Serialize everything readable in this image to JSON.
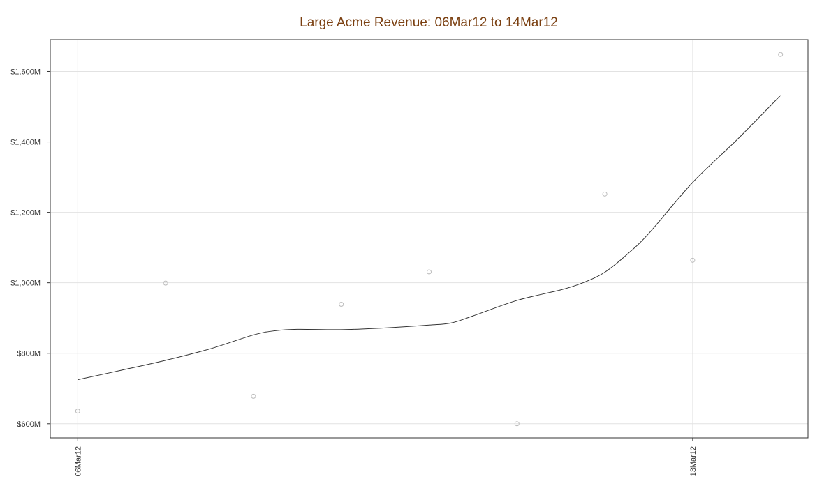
{
  "colors": {
    "title": "#7a3f10",
    "grid": "#e2e2e2",
    "frame": "#333333",
    "trend_line": "#333333",
    "points": "#bbbbbb",
    "tick_label": "#333333"
  },
  "chart_data": {
    "type": "scatter",
    "title": "Large Acme Revenue: 06Mar12 to 14Mar12",
    "xlabel": "",
    "ylabel": "",
    "xlim": [
      "2012-03-05 16:30",
      "2012-03-14 07:30"
    ],
    "ylim": [
      560,
      1690
    ],
    "grid": true,
    "legend": "none",
    "x_ticks": [
      {
        "date": "2012-03-06",
        "label": "06Mar12"
      },
      {
        "date": "2012-03-13",
        "label": "13Mar12"
      }
    ],
    "y_ticks": [
      {
        "value": 600,
        "label": "$600M"
      },
      {
        "value": 800,
        "label": "$800M"
      },
      {
        "value": 1000,
        "label": "$1,000M"
      },
      {
        "value": 1200,
        "label": "$1,200M"
      },
      {
        "value": 1400,
        "label": "$1,400M"
      },
      {
        "value": 1600,
        "label": "$1,600M"
      }
    ],
    "y_units": "$M",
    "series": [
      {
        "kind": "points",
        "x": [
          "2012-03-06 00:00",
          "2012-03-07 00:00",
          "2012-03-08 00:00",
          "2012-03-09 00:00",
          "2012-03-10 00:00",
          "2012-03-11 00:00",
          "2012-03-12 00:00",
          "2012-03-13 00:00",
          "2012-03-14 00:00"
        ],
        "values": [
          636,
          999,
          678,
          939,
          1031,
          600,
          1252,
          1064,
          1648
        ]
      },
      {
        "kind": "smooth",
        "x": [
          "2012-03-06 00:00",
          "2012-03-06 12:00",
          "2012-03-07 00:00",
          "2012-03-07 12:00",
          "2012-03-08 00:00",
          "2012-03-08 06:00",
          "2012-03-08 12:00",
          "2012-03-09 00:00",
          "2012-03-09 12:00",
          "2012-03-10 00:00",
          "2012-03-10 06:00",
          "2012-03-10 12:00",
          "2012-03-11 00:00",
          "2012-03-11 12:00",
          "2012-03-11 18:00",
          "2012-03-12 00:00",
          "2012-03-12 06:00",
          "2012-03-12 12:00",
          "2012-03-13 00:00",
          "2012-03-13 12:00",
          "2012-03-14 00:00"
        ],
        "values": [
          725,
          752,
          780,
          812,
          852,
          864,
          868,
          867,
          872,
          880,
          886,
          906,
          950,
          980,
          1000,
          1030,
          1080,
          1140,
          1285,
          1405,
          1532
        ]
      }
    ]
  }
}
